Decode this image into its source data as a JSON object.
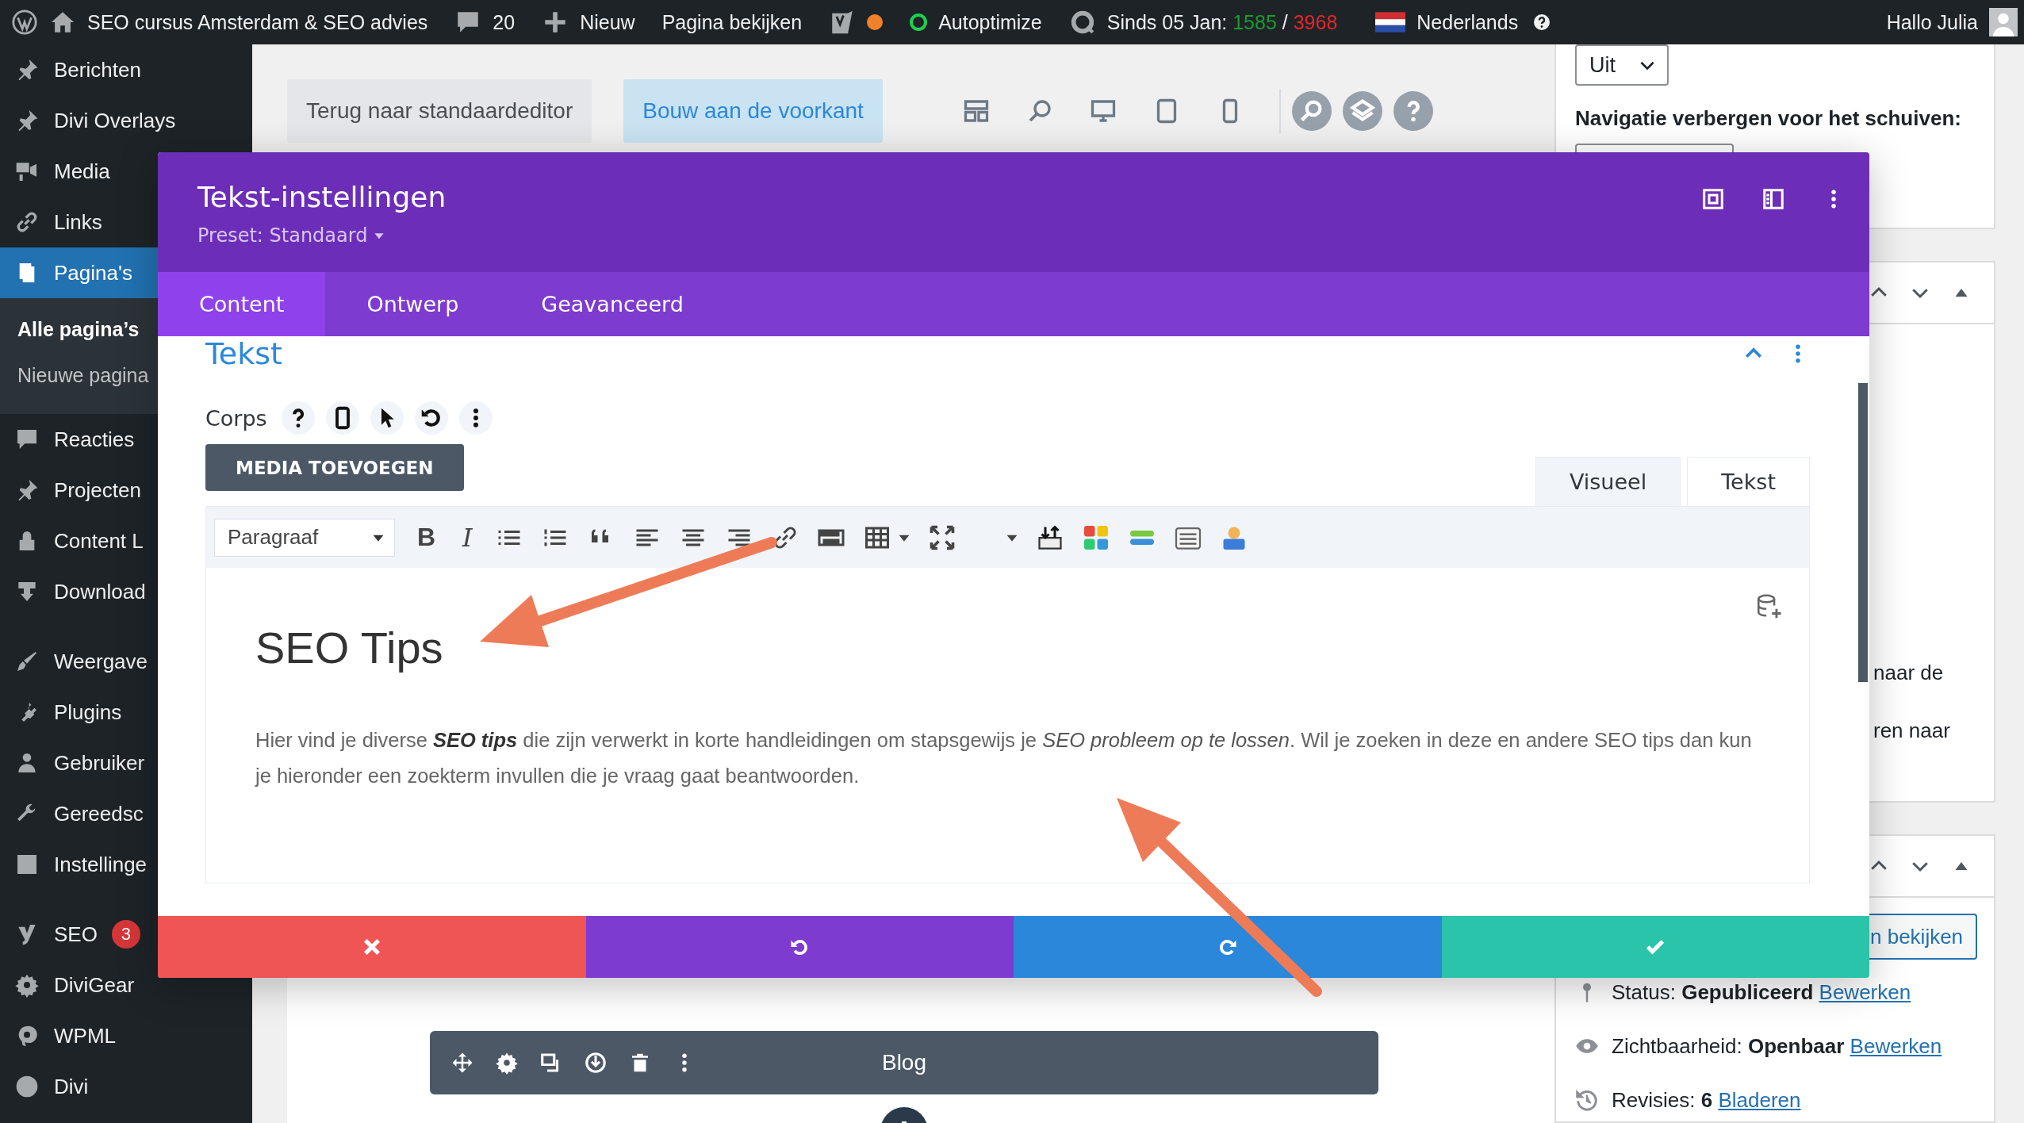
{
  "admin_bar": {
    "site_name": "SEO cursus Amsterdam & SEO advies",
    "comments": "20",
    "new_label": "Nieuw",
    "view_page": "Pagina bekijken",
    "autoptimize": "Autoptimize",
    "stats": {
      "label": "Sinds 05 Jan:",
      "visits": "1585",
      "separator": "/",
      "views": "3968"
    },
    "language": "Nederlands",
    "greeting": "Hallo Julia"
  },
  "sidebar": {
    "groups": [
      {
        "items": [
          {
            "label": "Berichten",
            "selected": false
          },
          {
            "label": "Divi Overlays",
            "selected": false
          },
          {
            "label": "Media",
            "selected": false
          },
          {
            "label": "Links",
            "selected": false
          },
          {
            "label": "Pagina's",
            "selected": true,
            "children": [
              {
                "label": "Alle pagina’s",
                "selected": true
              },
              {
                "label": "Nieuwe pagina",
                "selected": false
              }
            ]
          },
          {
            "label": "Reacties",
            "selected": false
          },
          {
            "label": "Projecten",
            "selected": false
          },
          {
            "label": "Content L",
            "selected": false
          },
          {
            "label": "Download",
            "selected": false
          }
        ]
      },
      {
        "items": [
          {
            "label": "Weergave",
            "selected": false
          },
          {
            "label": "Plugins",
            "selected": false
          },
          {
            "label": "Gebruiker",
            "selected": false
          },
          {
            "label": "Gereedsc",
            "selected": false
          },
          {
            "label": "Instellinge",
            "selected": false
          }
        ]
      },
      {
        "items": [
          {
            "label": "SEO",
            "selected": false,
            "badge": "3"
          },
          {
            "label": "DiviGear",
            "selected": false
          },
          {
            "label": "WPML",
            "selected": false
          },
          {
            "label": "Divi",
            "selected": false
          }
        ]
      }
    ]
  },
  "editor_toolbar": {
    "buttons": [
      {
        "label": "Terug naar standaardeditor",
        "kind": "secondary"
      },
      {
        "label": "Bouw aan de voorkant",
        "kind": "primary"
      }
    ]
  },
  "modal": {
    "title": "Tekst-instellingen",
    "preset": "Preset: Standaard",
    "tabs": [
      {
        "label": "Content",
        "selected": true
      },
      {
        "label": "Ontwerp",
        "selected": false
      },
      {
        "label": "Geavanceerd",
        "selected": false
      }
    ],
    "section": {
      "title": "Tekst",
      "expanded": true
    },
    "field_label": "Corps",
    "media_button": "MEDIA TOEVOEGEN",
    "editor_tabs": [
      {
        "label": "Visueel",
        "selected": true
      },
      {
        "label": "Tekst",
        "selected": false
      }
    ],
    "format_select": "Paragraaf",
    "format_buttons": [
      "B",
      "I"
    ],
    "content": {
      "heading": "SEO Tips",
      "paragraph": "Hier vind je diverse **SEO tips** die zijn verwerkt in korte handleidingen om stapsgewijs je *SEO probleem op te lossen*. Wil je zoeken in deze en andere SEO tips dan kun je hieronder een zoekterm invullen die je vraag gaat beantwoorden."
    }
  },
  "builder": {
    "module_title": "Blog"
  },
  "right_panel": {
    "select_value": "Uit",
    "nav_label": "Navigatie verbergen voor het schuiven:",
    "fragments": [
      "naar de",
      "ren naar"
    ],
    "view_button": "n bekijken",
    "status_rows": [
      {
        "label": "Status:",
        "value": "Gepubliceerd",
        "link": "Bewerken"
      },
      {
        "label": "Zichtbaarheid:",
        "value": "Openbaar",
        "link": "Bewerken"
      },
      {
        "label": "Revisies:",
        "value": "6",
        "link": "Bladeren"
      }
    ]
  }
}
